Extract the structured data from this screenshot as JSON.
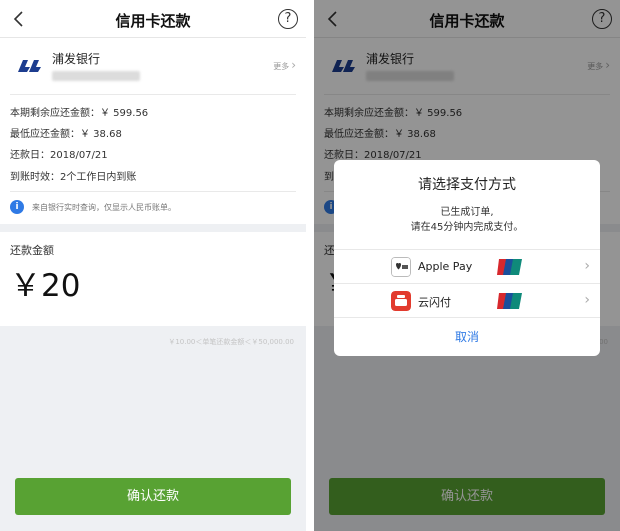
{
  "header": {
    "title": "信用卡还款",
    "help": "?"
  },
  "bank": {
    "name": "浦发银行",
    "more": "更多"
  },
  "info": {
    "rows": [
      {
        "label": "本期剩余应还金额：",
        "value": "￥ 599.56"
      },
      {
        "label": "最低应还金额：",
        "value": "￥ 38.68"
      },
      {
        "label": "还款日：",
        "value": "2018/07/21"
      },
      {
        "label": "到账时效：",
        "value": "2个工作日内到账"
      }
    ],
    "notice": "来自银行实时查询，仅显示人民币账单。",
    "notice_icon": "i"
  },
  "amount": {
    "label": "还款金额",
    "value": "￥20"
  },
  "range": "￥10.00＜单笔还款金额＜￥50,000.00",
  "confirm_label": "确认还款",
  "dialog": {
    "title": "请选择支付方式",
    "line1": "已生成订单,",
    "line2": "请在45分钟内完成支付。",
    "options": [
      {
        "label": "Apple Pay",
        "icon": "apple-pay-icon"
      },
      {
        "label": "云闪付",
        "icon": "cloud-quickpass-icon"
      }
    ],
    "cancel": "取消"
  },
  "colors": {
    "accent": "#58a233",
    "link": "#2f7ae5",
    "bank_logo": "#1d3d8f",
    "unionpay_red": "#d7282d",
    "unionpay_blue": "#1a4f9c",
    "unionpay_green": "#0f8a7a"
  }
}
